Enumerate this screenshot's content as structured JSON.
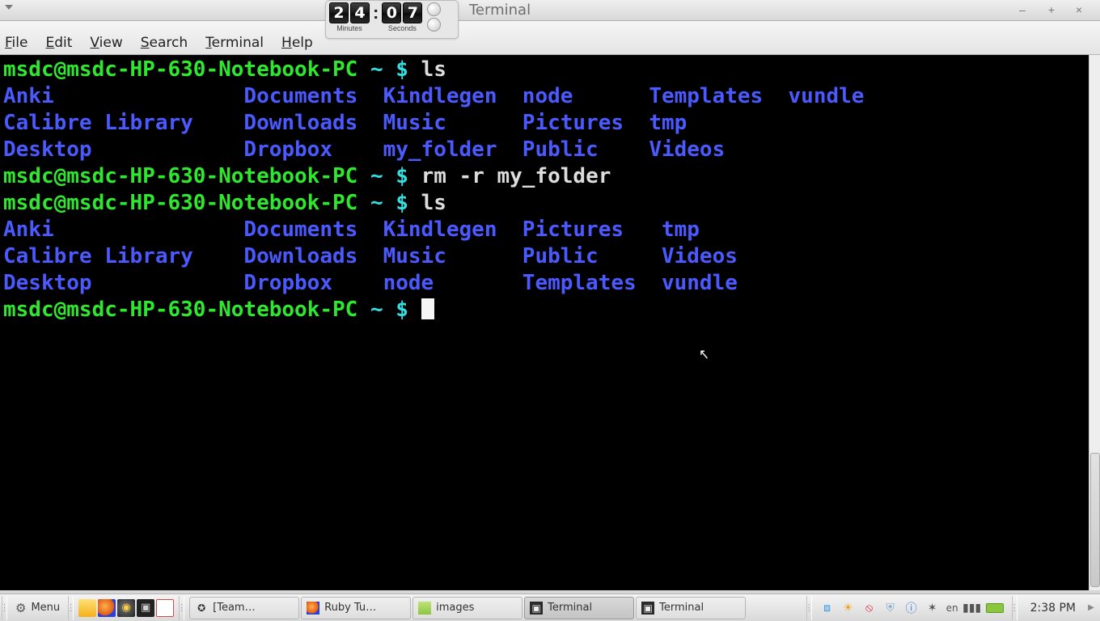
{
  "window": {
    "title": "Terminal",
    "min": "–",
    "max": "+",
    "close": "×"
  },
  "timer": {
    "minutes_d1": "2",
    "minutes_d2": "4",
    "seconds_d1": "0",
    "seconds_d2": "7",
    "minutes_label": "Minutes",
    "seconds_label": "Seconds"
  },
  "menubar": {
    "file": "File",
    "edit": "Edit",
    "view": "View",
    "search": "Search",
    "terminal": "Terminal",
    "help": "Help"
  },
  "term": {
    "prompt_user": "msdc@msdc-HP-630-Notebook-PC",
    "prompt_path": " ~ $ ",
    "cmd1": "ls",
    "ls1_r1": "Anki               Documents  Kindlegen  node      Templates  vundle",
    "ls1_r2": "Calibre Library    Downloads  Music      Pictures  tmp",
    "ls1_r3": "Desktop            Dropbox    my_folder  Public    Videos",
    "cmd2": "rm -r my_folder",
    "cmd3": "ls",
    "ls2_r1": "Anki               Documents  Kindlegen  Pictures   tmp",
    "ls2_r2": "Calibre Library    Downloads  Music      Public     Videos",
    "ls2_r3": "Desktop            Dropbox    node       Templates  vundle"
  },
  "taskbar": {
    "menu_label": "Menu",
    "tasks": {
      "t0": "[Team…",
      "t1": "Ruby Tu…",
      "t2": "images",
      "t3": "Terminal",
      "t4": "Terminal"
    },
    "lang": "en",
    "clock": "2:38 PM"
  }
}
